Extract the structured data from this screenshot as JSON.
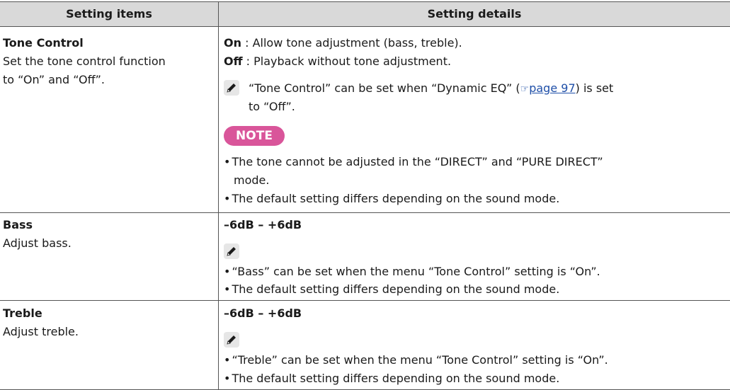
{
  "header": {
    "col1": "Setting items",
    "col2": "Setting details"
  },
  "rows": {
    "tone": {
      "title": "Tone Control",
      "desc_line1": "Set the tone control function",
      "desc_line2": "to “On” and “Off”.",
      "on_label": "On",
      "on_text": " : Allow tone adjustment (bass, treble).",
      "off_label": "Off",
      "off_text": " : Playback without tone adjustment.",
      "tip_line1_a": "“Tone Control” can be set when “Dynamic EQ” (",
      "tip_link": "page 97",
      "tip_line1_b": ") is set",
      "tip_line2": "to “Off”.",
      "note_label": "NOTE",
      "note1_line1": "The tone cannot be adjusted in the “DIRECT” and “PURE DIRECT”",
      "note1_line2": "mode.",
      "note2": "The default setting differs depending on the sound mode."
    },
    "bass": {
      "title": "Bass",
      "desc": "Adjust bass.",
      "range": "–6dB – +6dB",
      "bullet1": "“Bass” can be set when the menu “Tone Control” setting is “On”.",
      "bullet2": "The default setting differs depending on the sound mode."
    },
    "treble": {
      "title": "Treble",
      "desc": "Adjust treble.",
      "range": "–6dB – +6dB",
      "bullet1": "“Treble” can be set when the menu “Tone Control” setting is “On”.",
      "bullet2": "The default setting differs depending on the sound mode."
    }
  },
  "icons": {
    "pencil": "pencil-icon",
    "page_ref": "page-reference-icon"
  },
  "colors": {
    "header_bg": "#d9d9d9",
    "note_badge": "#d9559a",
    "link": "#1f4fa8"
  }
}
